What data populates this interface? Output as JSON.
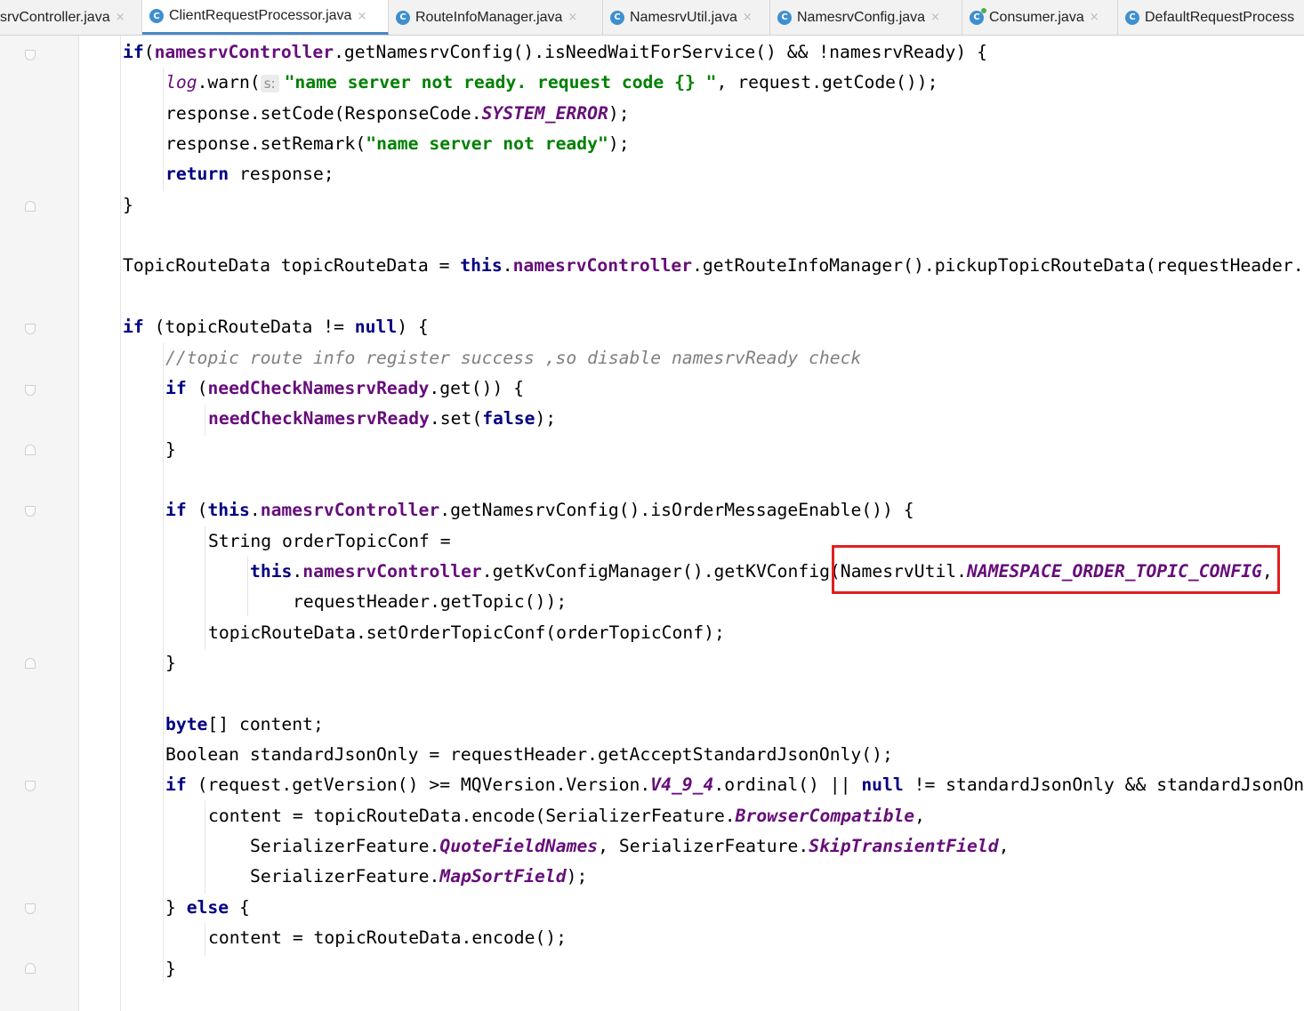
{
  "tabs": [
    {
      "label": "srvController.java",
      "icon": "class-icon",
      "active": false
    },
    {
      "label": "ClientRequestProcessor.java",
      "icon": "class-icon",
      "active": true
    },
    {
      "label": "RouteInfoManager.java",
      "icon": "class-icon",
      "active": false
    },
    {
      "label": "NamesrvUtil.java",
      "icon": "class-icon",
      "active": false
    },
    {
      "label": "NamesrvConfig.java",
      "icon": "class-icon",
      "active": false
    },
    {
      "label": "Consumer.java",
      "icon": "class-icon",
      "active": false
    },
    {
      "label": "DefaultRequestProcess",
      "icon": "class-icon",
      "active": false
    }
  ],
  "icons": {
    "class_glyph": "C",
    "close_glyph": "×"
  },
  "editor": {
    "hint_label": "s:",
    "highlight_color": "#e02020",
    "lines": [
      {
        "indent": 1,
        "tokens": [
          [
            "kw",
            "if"
          ],
          [
            "",
            "("
          ],
          [
            "fld",
            "namesrvController"
          ],
          [
            "",
            ".getNamesrvConfig().isNeedWaitForService() && !namesrvReady) {"
          ]
        ]
      },
      {
        "indent": 2,
        "tokens": [
          [
            "lg",
            "log"
          ],
          [
            "",
            ".warn("
          ],
          [
            "hint",
            "s:"
          ],
          [
            "str",
            "\"name server not ready. request code {} \""
          ],
          [
            "",
            ", request.getCode());"
          ]
        ]
      },
      {
        "indent": 2,
        "tokens": [
          [
            "",
            "response.setCode(ResponseCode."
          ],
          [
            "st",
            "SYSTEM_ERROR"
          ],
          [
            "",
            ");"
          ]
        ]
      },
      {
        "indent": 2,
        "tokens": [
          [
            "",
            "response.setRemark("
          ],
          [
            "str",
            "\"name server not ready\""
          ],
          [
            "",
            ");"
          ]
        ]
      },
      {
        "indent": 2,
        "tokens": [
          [
            "kw",
            "return"
          ],
          [
            "",
            " response;"
          ]
        ]
      },
      {
        "indent": 1,
        "tokens": [
          [
            "",
            "}"
          ]
        ]
      },
      {
        "indent": 0,
        "tokens": []
      },
      {
        "indent": 1,
        "tokens": [
          [
            "",
            "TopicRouteData topicRouteData = "
          ],
          [
            "kw",
            "this"
          ],
          [
            "",
            "."
          ],
          [
            "fld",
            "namesrvController"
          ],
          [
            "",
            ".getRouteInfoManager().pickupTopicRouteData(requestHeader."
          ]
        ]
      },
      {
        "indent": 0,
        "tokens": []
      },
      {
        "indent": 1,
        "tokens": [
          [
            "kw",
            "if"
          ],
          [
            "",
            " (topicRouteData != "
          ],
          [
            "kw",
            "null"
          ],
          [
            "",
            ") {"
          ]
        ]
      },
      {
        "indent": 2,
        "tokens": [
          [
            "cm",
            "//topic route info register success ,so disable namesrvReady check"
          ]
        ]
      },
      {
        "indent": 2,
        "tokens": [
          [
            "kw",
            "if"
          ],
          [
            "",
            " ("
          ],
          [
            "fld",
            "needCheckNamesrvReady"
          ],
          [
            "",
            ".get()) {"
          ]
        ]
      },
      {
        "indent": 3,
        "tokens": [
          [
            "fld",
            "needCheckNamesrvReady"
          ],
          [
            "",
            ".set("
          ],
          [
            "kw",
            "false"
          ],
          [
            "",
            ");"
          ]
        ]
      },
      {
        "indent": 2,
        "tokens": [
          [
            "",
            "}"
          ]
        ]
      },
      {
        "indent": 0,
        "tokens": []
      },
      {
        "indent": 2,
        "tokens": [
          [
            "kw",
            "if"
          ],
          [
            "",
            " ("
          ],
          [
            "kw",
            "this"
          ],
          [
            "",
            "."
          ],
          [
            "fld",
            "namesrvController"
          ],
          [
            "",
            ".getNamesrvConfig().isOrderMessageEnable()) {"
          ]
        ]
      },
      {
        "indent": 3,
        "tokens": [
          [
            "",
            "String orderTopicConf ="
          ]
        ]
      },
      {
        "indent": 4,
        "tokens": [
          [
            "kw",
            "this"
          ],
          [
            "",
            "."
          ],
          [
            "fld",
            "namesrvController"
          ],
          [
            "",
            ".getKvConfigManager().getKVConfig(NamesrvUtil."
          ],
          [
            "st",
            "NAMESPACE_ORDER_TOPIC_CONFIG"
          ],
          [
            "",
            ","
          ]
        ]
      },
      {
        "indent": 5,
        "tokens": [
          [
            "",
            "requestHeader.getTopic());"
          ]
        ]
      },
      {
        "indent": 3,
        "tokens": [
          [
            "",
            "topicRouteData.setOrderTopicConf(orderTopicConf);"
          ]
        ]
      },
      {
        "indent": 2,
        "tokens": [
          [
            "",
            "}"
          ]
        ]
      },
      {
        "indent": 0,
        "tokens": []
      },
      {
        "indent": 2,
        "tokens": [
          [
            "kw",
            "byte"
          ],
          [
            "",
            "[] content;"
          ]
        ]
      },
      {
        "indent": 2,
        "tokens": [
          [
            "",
            "Boolean standardJsonOnly = requestHeader.getAcceptStandardJsonOnly();"
          ]
        ]
      },
      {
        "indent": 2,
        "tokens": [
          [
            "kw",
            "if"
          ],
          [
            "",
            " (request.getVersion() >= MQVersion.Version."
          ],
          [
            "st",
            "V4_9_4"
          ],
          [
            "",
            ".ordinal() || "
          ],
          [
            "kw",
            "null"
          ],
          [
            "",
            " != standardJsonOnly && standardJsonOn"
          ]
        ]
      },
      {
        "indent": 3,
        "tokens": [
          [
            "",
            "content = topicRouteData.encode(SerializerFeature."
          ],
          [
            "st",
            "BrowserCompatible"
          ],
          [
            "",
            ","
          ]
        ]
      },
      {
        "indent": 4,
        "tokens": [
          [
            "",
            "SerializerFeature."
          ],
          [
            "st",
            "QuoteFieldNames"
          ],
          [
            "",
            ", SerializerFeature."
          ],
          [
            "st",
            "SkipTransientField"
          ],
          [
            "",
            ","
          ]
        ]
      },
      {
        "indent": 4,
        "tokens": [
          [
            "",
            "SerializerFeature."
          ],
          [
            "st",
            "MapSortField"
          ],
          [
            "",
            ");"
          ]
        ]
      },
      {
        "indent": 2,
        "tokens": [
          [
            "",
            "} "
          ],
          [
            "kw",
            "else"
          ],
          [
            "",
            " {"
          ]
        ]
      },
      {
        "indent": 3,
        "tokens": [
          [
            "",
            "content = topicRouteData.encode();"
          ]
        ]
      },
      {
        "indent": 2,
        "tokens": [
          [
            "",
            "}"
          ]
        ]
      }
    ]
  }
}
